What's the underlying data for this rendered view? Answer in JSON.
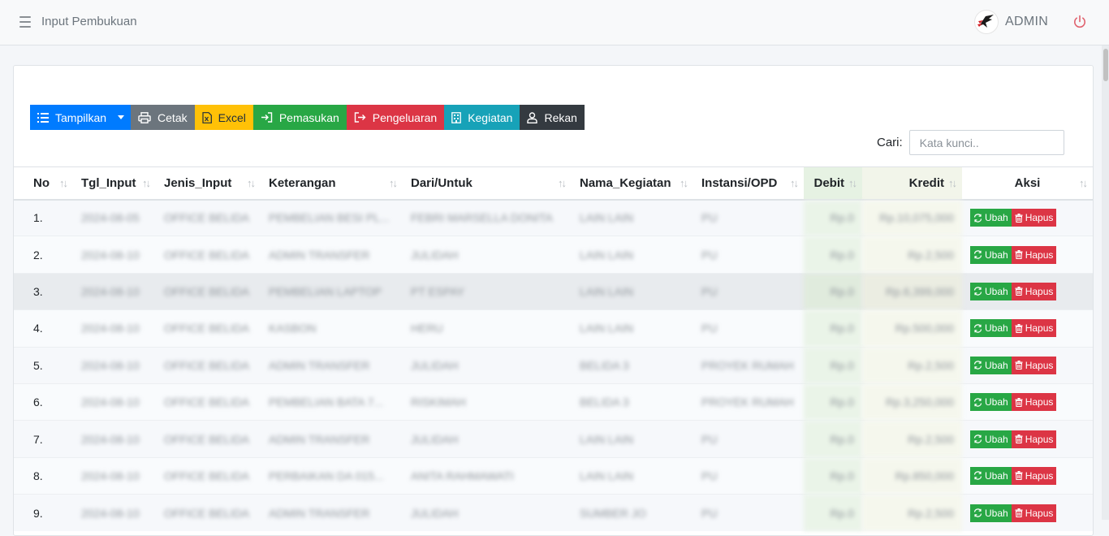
{
  "navbar": {
    "title": "Input Pembukuan",
    "user": "ADMIN"
  },
  "toolbar": {
    "tampilkan": "Tampilkan",
    "cetak": "Cetak",
    "excel": "Excel",
    "pemasukan": "Pemasukan",
    "pengeluaran": "Pengeluaran",
    "kegiatan": "Kegiatan",
    "rekan": "Rekan"
  },
  "search": {
    "label": "Cari:",
    "placeholder": "Kata kunci.."
  },
  "table": {
    "headers": [
      "No",
      "Tgl_Input",
      "Jenis_Input",
      "Keterangan",
      "Dari/Untuk",
      "Nama_Kegiatan",
      "Instansi/OPD",
      "Debit",
      "Kredit",
      "Aksi"
    ],
    "ubah_label": "Ubah",
    "hapus_label": "Hapus",
    "rows": [
      [
        "1.",
        "2024-08-05",
        "OFFICE BELIDA",
        "PEMBELIAN BESI PL...",
        "FEBRI MARSELLA DONITA",
        "LAIN LAIN",
        "PU",
        "Rp.0",
        "Rp.10,075,000"
      ],
      [
        "2.",
        "2024-08-10",
        "OFFICE BELIDA",
        "ADMIN TRANSFER",
        "JULIDAH",
        "LAIN LAIN",
        "PU",
        "Rp.0",
        "Rp.2,500"
      ],
      [
        "3.",
        "2024-08-10",
        "OFFICE BELIDA",
        "PEMBELIAN LAPTOP",
        "PT ESPAY",
        "LAIN LAIN",
        "PU",
        "Rp.0",
        "Rp.6,399,000"
      ],
      [
        "4.",
        "2024-08-10",
        "OFFICE BELIDA",
        "KASBON",
        "HERU",
        "LAIN LAIN",
        "PU",
        "Rp.0",
        "Rp.500,000"
      ],
      [
        "5.",
        "2024-08-10",
        "OFFICE BELIDA",
        "ADMIN TRANSFER",
        "JULIDAH",
        "BELIDA 3",
        "PROYEK RUMAH",
        "Rp.0",
        "Rp.2,500"
      ],
      [
        "6.",
        "2024-08-10",
        "OFFICE BELIDA",
        "PEMBELIAN BATA 7...",
        "RISKIMAH",
        "BELIDA 3",
        "PROYEK RUMAH",
        "Rp.0",
        "Rp.3,250,000"
      ],
      [
        "7.",
        "2024-08-10",
        "OFFICE BELIDA",
        "ADMIN TRANSFER",
        "JULIDAH",
        "LAIN LAIN",
        "PU",
        "Rp.0",
        "Rp.2,500"
      ],
      [
        "8.",
        "2024-08-10",
        "OFFICE BELIDA",
        "PERBAIKAN DA 015...",
        "ANITA RAHMAWATI",
        "LAIN LAIN",
        "PU",
        "Rp.0",
        "Rp.850,000"
      ],
      [
        "9.",
        "2024-08-10",
        "OFFICE BELIDA",
        "ADMIN TRANSFER",
        "JULIDAH",
        "SUMBER JO",
        "PU",
        "Rp.0",
        "Rp.2,500"
      ]
    ]
  },
  "colors": {
    "primary": "#007bff",
    "secondary": "#6c757d",
    "warning": "#ffc107",
    "success": "#28a745",
    "danger": "#dc3545",
    "info": "#17a2b8",
    "dark": "#343a40"
  }
}
